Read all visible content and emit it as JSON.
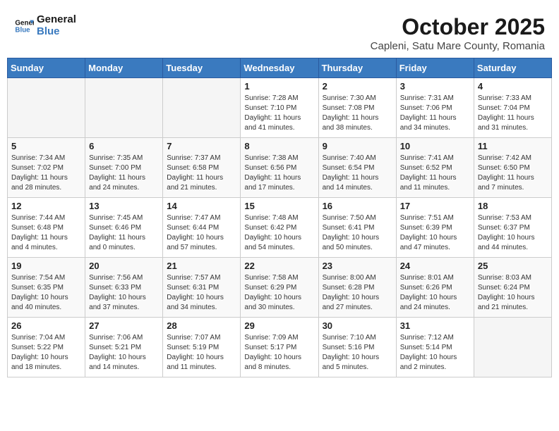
{
  "header": {
    "logo_general": "General",
    "logo_blue": "Blue",
    "month": "October 2025",
    "location": "Capleni, Satu Mare County, Romania"
  },
  "weekdays": [
    "Sunday",
    "Monday",
    "Tuesday",
    "Wednesday",
    "Thursday",
    "Friday",
    "Saturday"
  ],
  "weeks": [
    [
      {
        "day": "",
        "info": ""
      },
      {
        "day": "",
        "info": ""
      },
      {
        "day": "",
        "info": ""
      },
      {
        "day": "1",
        "info": "Sunrise: 7:28 AM\nSunset: 7:10 PM\nDaylight: 11 hours\nand 41 minutes."
      },
      {
        "day": "2",
        "info": "Sunrise: 7:30 AM\nSunset: 7:08 PM\nDaylight: 11 hours\nand 38 minutes."
      },
      {
        "day": "3",
        "info": "Sunrise: 7:31 AM\nSunset: 7:06 PM\nDaylight: 11 hours\nand 34 minutes."
      },
      {
        "day": "4",
        "info": "Sunrise: 7:33 AM\nSunset: 7:04 PM\nDaylight: 11 hours\nand 31 minutes."
      }
    ],
    [
      {
        "day": "5",
        "info": "Sunrise: 7:34 AM\nSunset: 7:02 PM\nDaylight: 11 hours\nand 28 minutes."
      },
      {
        "day": "6",
        "info": "Sunrise: 7:35 AM\nSunset: 7:00 PM\nDaylight: 11 hours\nand 24 minutes."
      },
      {
        "day": "7",
        "info": "Sunrise: 7:37 AM\nSunset: 6:58 PM\nDaylight: 11 hours\nand 21 minutes."
      },
      {
        "day": "8",
        "info": "Sunrise: 7:38 AM\nSunset: 6:56 PM\nDaylight: 11 hours\nand 17 minutes."
      },
      {
        "day": "9",
        "info": "Sunrise: 7:40 AM\nSunset: 6:54 PM\nDaylight: 11 hours\nand 14 minutes."
      },
      {
        "day": "10",
        "info": "Sunrise: 7:41 AM\nSunset: 6:52 PM\nDaylight: 11 hours\nand 11 minutes."
      },
      {
        "day": "11",
        "info": "Sunrise: 7:42 AM\nSunset: 6:50 PM\nDaylight: 11 hours\nand 7 minutes."
      }
    ],
    [
      {
        "day": "12",
        "info": "Sunrise: 7:44 AM\nSunset: 6:48 PM\nDaylight: 11 hours\nand 4 minutes."
      },
      {
        "day": "13",
        "info": "Sunrise: 7:45 AM\nSunset: 6:46 PM\nDaylight: 11 hours\nand 0 minutes."
      },
      {
        "day": "14",
        "info": "Sunrise: 7:47 AM\nSunset: 6:44 PM\nDaylight: 10 hours\nand 57 minutes."
      },
      {
        "day": "15",
        "info": "Sunrise: 7:48 AM\nSunset: 6:42 PM\nDaylight: 10 hours\nand 54 minutes."
      },
      {
        "day": "16",
        "info": "Sunrise: 7:50 AM\nSunset: 6:41 PM\nDaylight: 10 hours\nand 50 minutes."
      },
      {
        "day": "17",
        "info": "Sunrise: 7:51 AM\nSunset: 6:39 PM\nDaylight: 10 hours\nand 47 minutes."
      },
      {
        "day": "18",
        "info": "Sunrise: 7:53 AM\nSunset: 6:37 PM\nDaylight: 10 hours\nand 44 minutes."
      }
    ],
    [
      {
        "day": "19",
        "info": "Sunrise: 7:54 AM\nSunset: 6:35 PM\nDaylight: 10 hours\nand 40 minutes."
      },
      {
        "day": "20",
        "info": "Sunrise: 7:56 AM\nSunset: 6:33 PM\nDaylight: 10 hours\nand 37 minutes."
      },
      {
        "day": "21",
        "info": "Sunrise: 7:57 AM\nSunset: 6:31 PM\nDaylight: 10 hours\nand 34 minutes."
      },
      {
        "day": "22",
        "info": "Sunrise: 7:58 AM\nSunset: 6:29 PM\nDaylight: 10 hours\nand 30 minutes."
      },
      {
        "day": "23",
        "info": "Sunrise: 8:00 AM\nSunset: 6:28 PM\nDaylight: 10 hours\nand 27 minutes."
      },
      {
        "day": "24",
        "info": "Sunrise: 8:01 AM\nSunset: 6:26 PM\nDaylight: 10 hours\nand 24 minutes."
      },
      {
        "day": "25",
        "info": "Sunrise: 8:03 AM\nSunset: 6:24 PM\nDaylight: 10 hours\nand 21 minutes."
      }
    ],
    [
      {
        "day": "26",
        "info": "Sunrise: 7:04 AM\nSunset: 5:22 PM\nDaylight: 10 hours\nand 18 minutes."
      },
      {
        "day": "27",
        "info": "Sunrise: 7:06 AM\nSunset: 5:21 PM\nDaylight: 10 hours\nand 14 minutes."
      },
      {
        "day": "28",
        "info": "Sunrise: 7:07 AM\nSunset: 5:19 PM\nDaylight: 10 hours\nand 11 minutes."
      },
      {
        "day": "29",
        "info": "Sunrise: 7:09 AM\nSunset: 5:17 PM\nDaylight: 10 hours\nand 8 minutes."
      },
      {
        "day": "30",
        "info": "Sunrise: 7:10 AM\nSunset: 5:16 PM\nDaylight: 10 hours\nand 5 minutes."
      },
      {
        "day": "31",
        "info": "Sunrise: 7:12 AM\nSunset: 5:14 PM\nDaylight: 10 hours\nand 2 minutes."
      },
      {
        "day": "",
        "info": ""
      }
    ]
  ]
}
